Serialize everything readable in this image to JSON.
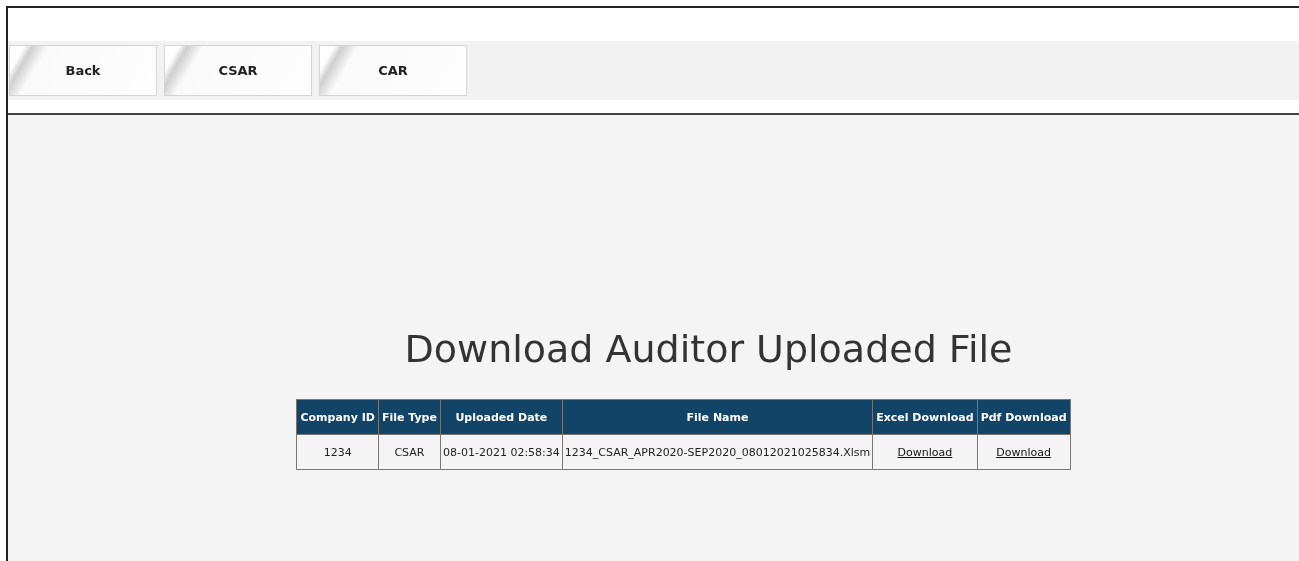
{
  "toolbar": {
    "buttons": [
      {
        "label": "Back"
      },
      {
        "label": "CSAR"
      },
      {
        "label": "CAR"
      }
    ]
  },
  "title": "Download Auditor Uploaded File",
  "table": {
    "columns": [
      "Company ID",
      "File Type",
      "Uploaded Date",
      "File Name",
      "Excel Download",
      "Pdf Download"
    ],
    "rows": [
      {
        "cells": [
          {
            "kind": "text",
            "text": "1234"
          },
          {
            "kind": "text",
            "text": "CSAR"
          },
          {
            "kind": "text",
            "text": "08-01-2021 02:58:34"
          },
          {
            "kind": "text",
            "text": "1234_CSAR_APR2020-SEP2020_08012021025834.Xlsm"
          },
          {
            "kind": "link",
            "text": "Download"
          },
          {
            "kind": "link",
            "text": "Download"
          }
        ]
      }
    ]
  }
}
